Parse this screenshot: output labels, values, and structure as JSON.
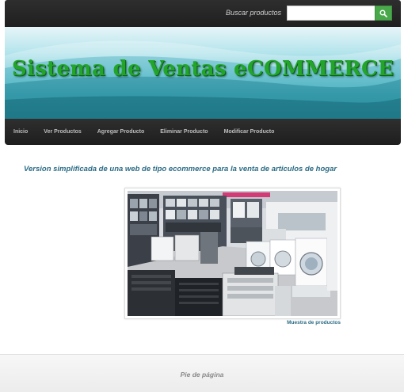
{
  "header": {
    "search_label": "Buscar productos",
    "search_value": "",
    "search_icon": "search-icon",
    "search_button_color": "#49a94a"
  },
  "banner": {
    "title": "Sistema de Ventas eCOMMERCE",
    "title_color": "#23a52a"
  },
  "nav": {
    "items": [
      {
        "label": "Inicio"
      },
      {
        "label": "Ver Productos"
      },
      {
        "label": "Agregar Producto"
      },
      {
        "label": "Eliminar Producto"
      },
      {
        "label": "Modificar Producto"
      }
    ]
  },
  "main": {
    "tagline": "Version simplificada de una web de tipo ecommerce para la venta de articulos de hogar",
    "image_caption": "Muestra de productos"
  },
  "footer": {
    "text": "Pie de página"
  }
}
